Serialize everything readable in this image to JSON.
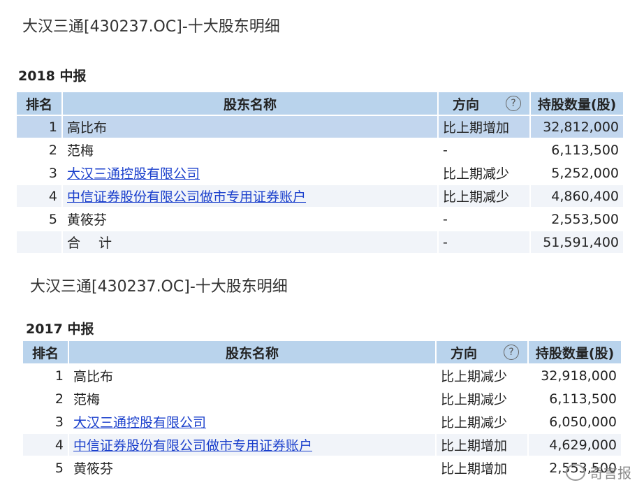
{
  "sections": [
    {
      "title": "大汉三通[430237.OC]-十大股东明细",
      "period": "2018 中报",
      "headers": {
        "rank": "排名",
        "name": "股东名称",
        "direction": "方向",
        "help": "?",
        "shares": "持股数量(股)"
      },
      "rows": [
        {
          "rank": "1",
          "name": "高比布",
          "direction": "比上期增加",
          "shares": "32,812,000"
        },
        {
          "rank": "2",
          "name": "范梅",
          "direction": "-",
          "shares": "6,113,500"
        },
        {
          "rank": "3",
          "name": "大汉三通控股有限公司",
          "direction": "比上期减少",
          "shares": "5,252,000"
        },
        {
          "rank": "4",
          "name": "中信证券股份有限公司做市专用证券账户",
          "direction": "比上期减少",
          "shares": "4,860,400"
        },
        {
          "rank": "5",
          "name": "黄筱芬",
          "direction": "-",
          "shares": "2,553,500"
        }
      ],
      "total": {
        "label": "合 计",
        "direction": "-",
        "shares": "51,591,400"
      }
    },
    {
      "title": "大汉三通[430237.OC]-十大股东明细",
      "period": "2017 中报",
      "headers": {
        "rank": "排名",
        "name": "股东名称",
        "direction": "方向",
        "help": "?",
        "shares": "持股数量(股)"
      },
      "rows": [
        {
          "rank": "1",
          "name": "高比布",
          "direction": "比上期减少",
          "shares": "32,918,000"
        },
        {
          "rank": "2",
          "name": "范梅",
          "direction": "比上期减少",
          "shares": "6,113,500"
        },
        {
          "rank": "3",
          "name": "大汉三通控股有限公司",
          "direction": "比上期减少",
          "shares": "6,050,000"
        },
        {
          "rank": "4",
          "name": "中信证券股份有限公司做市专用证券账户",
          "direction": "比上期增加",
          "shares": "4,629,000"
        },
        {
          "rank": "5",
          "name": "黄筱芬",
          "direction": "比上期增加",
          "shares": "2,553,500"
        }
      ]
    }
  ],
  "watermark": {
    "text": "奇言报",
    "icon": "wechat-icon"
  }
}
